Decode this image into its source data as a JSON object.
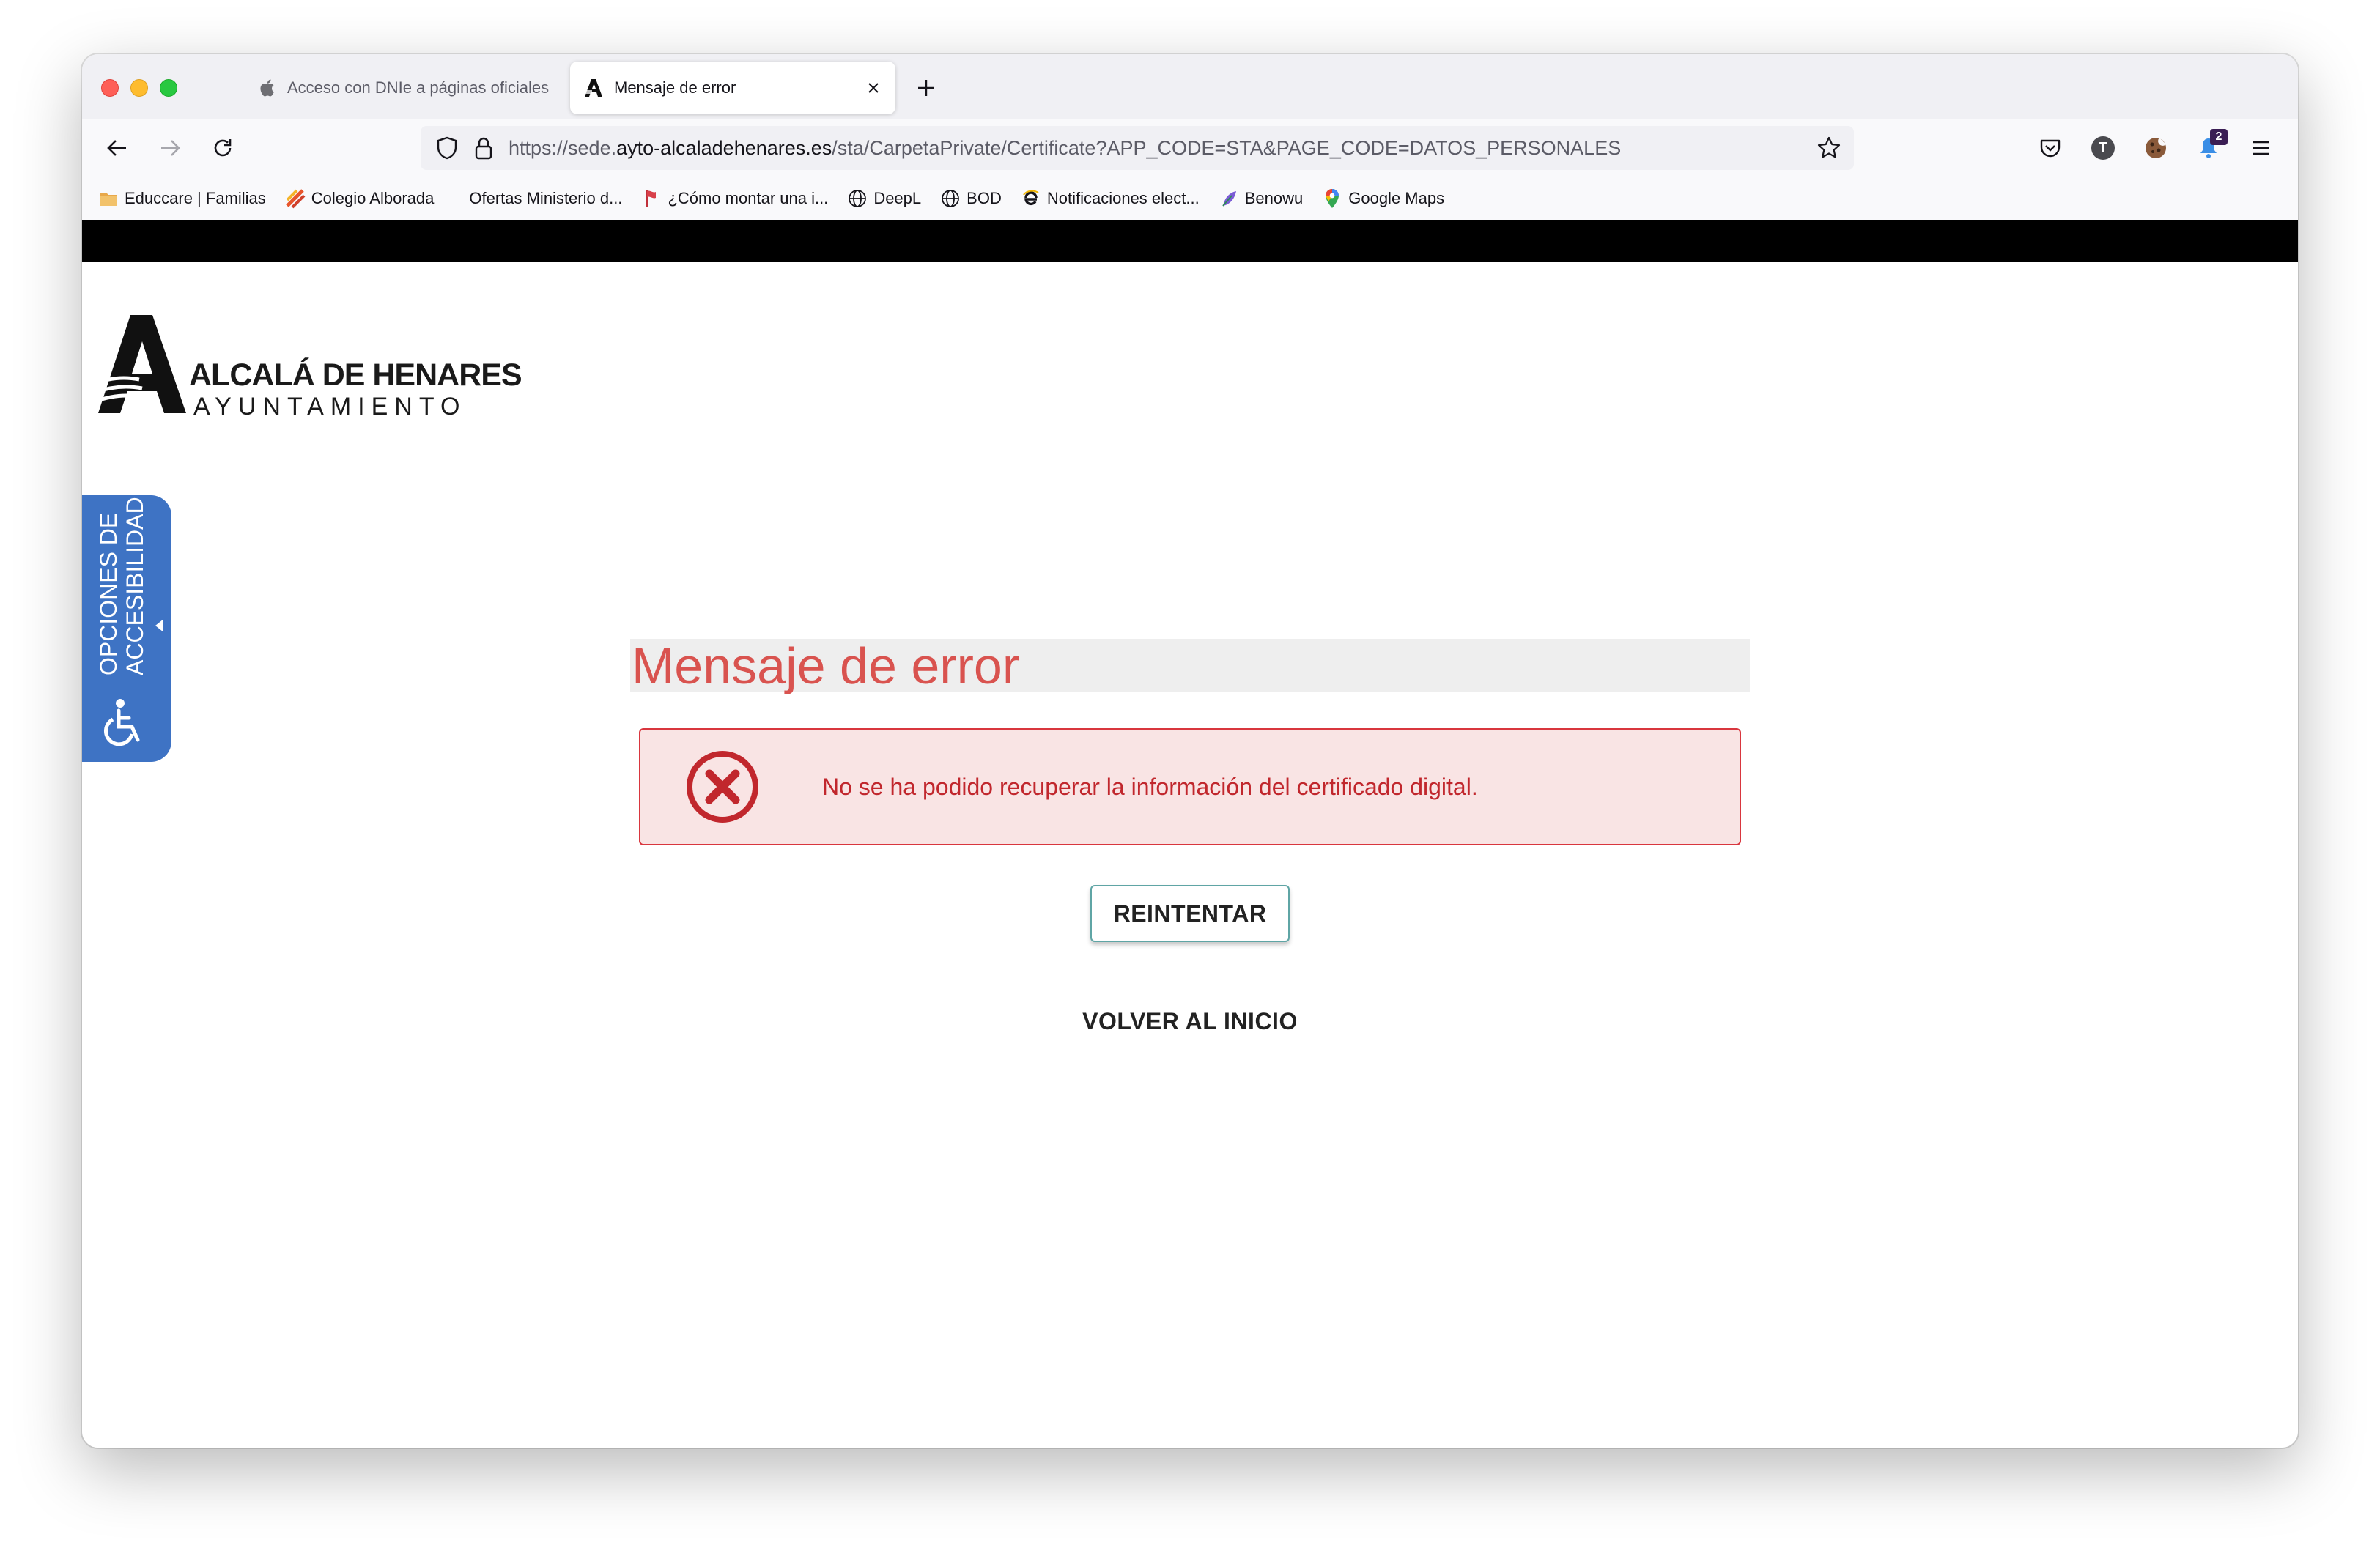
{
  "tabs": [
    {
      "label": "Acceso con DNIe a páginas oficiales",
      "icon": "apple-icon",
      "active": false
    },
    {
      "label": "Mensaje de error",
      "icon": "ayuntamiento-favicon",
      "active": true
    }
  ],
  "navbar": {
    "url_prefix": "https://sede.",
    "url_domain": "ayto-alcaladehenares.es",
    "url_path": "/sta/CarpetaPrivate/Certificate?APP_CODE=STA&PAGE_CODE=DATOS_PERSONALES",
    "profile_initial": "T",
    "notification_count": "2"
  },
  "bookmarks": [
    {
      "label": "Educcare | Familias",
      "icon": "folder-icon"
    },
    {
      "label": "Colegio Alborada",
      "icon": "school-icon"
    },
    {
      "label": "Ofertas Ministerio d...",
      "icon": "blank-icon"
    },
    {
      "label": "¿Cómo montar una i...",
      "icon": "flag-icon"
    },
    {
      "label": "DeepL",
      "icon": "globe-icon"
    },
    {
      "label": "BOD",
      "icon": "globe-icon"
    },
    {
      "label": "Notificaciones elect...",
      "icon": "e-icon"
    },
    {
      "label": "Benowu",
      "icon": "feather-icon"
    },
    {
      "label": "Google Maps",
      "icon": "maps-pin-icon"
    }
  ],
  "logo": {
    "name": "ALCALÁ DE HENARES",
    "subtitle": "AYUNTAMIENTO"
  },
  "accessibility": {
    "line1": "OPCIONES DE",
    "line2": "ACCESIBILIDAD"
  },
  "main": {
    "title": "Mensaje de error",
    "error_message": "No se ha podido recuperar la información del certificado digital.",
    "retry_label": "REINTENTAR",
    "home_label": "VOLVER AL INICIO"
  },
  "colors": {
    "error_title": "#d9534f",
    "alert_bg": "#f9e4e4",
    "alert_border": "#d9363e",
    "accessibility_bg": "#3e73c4"
  }
}
